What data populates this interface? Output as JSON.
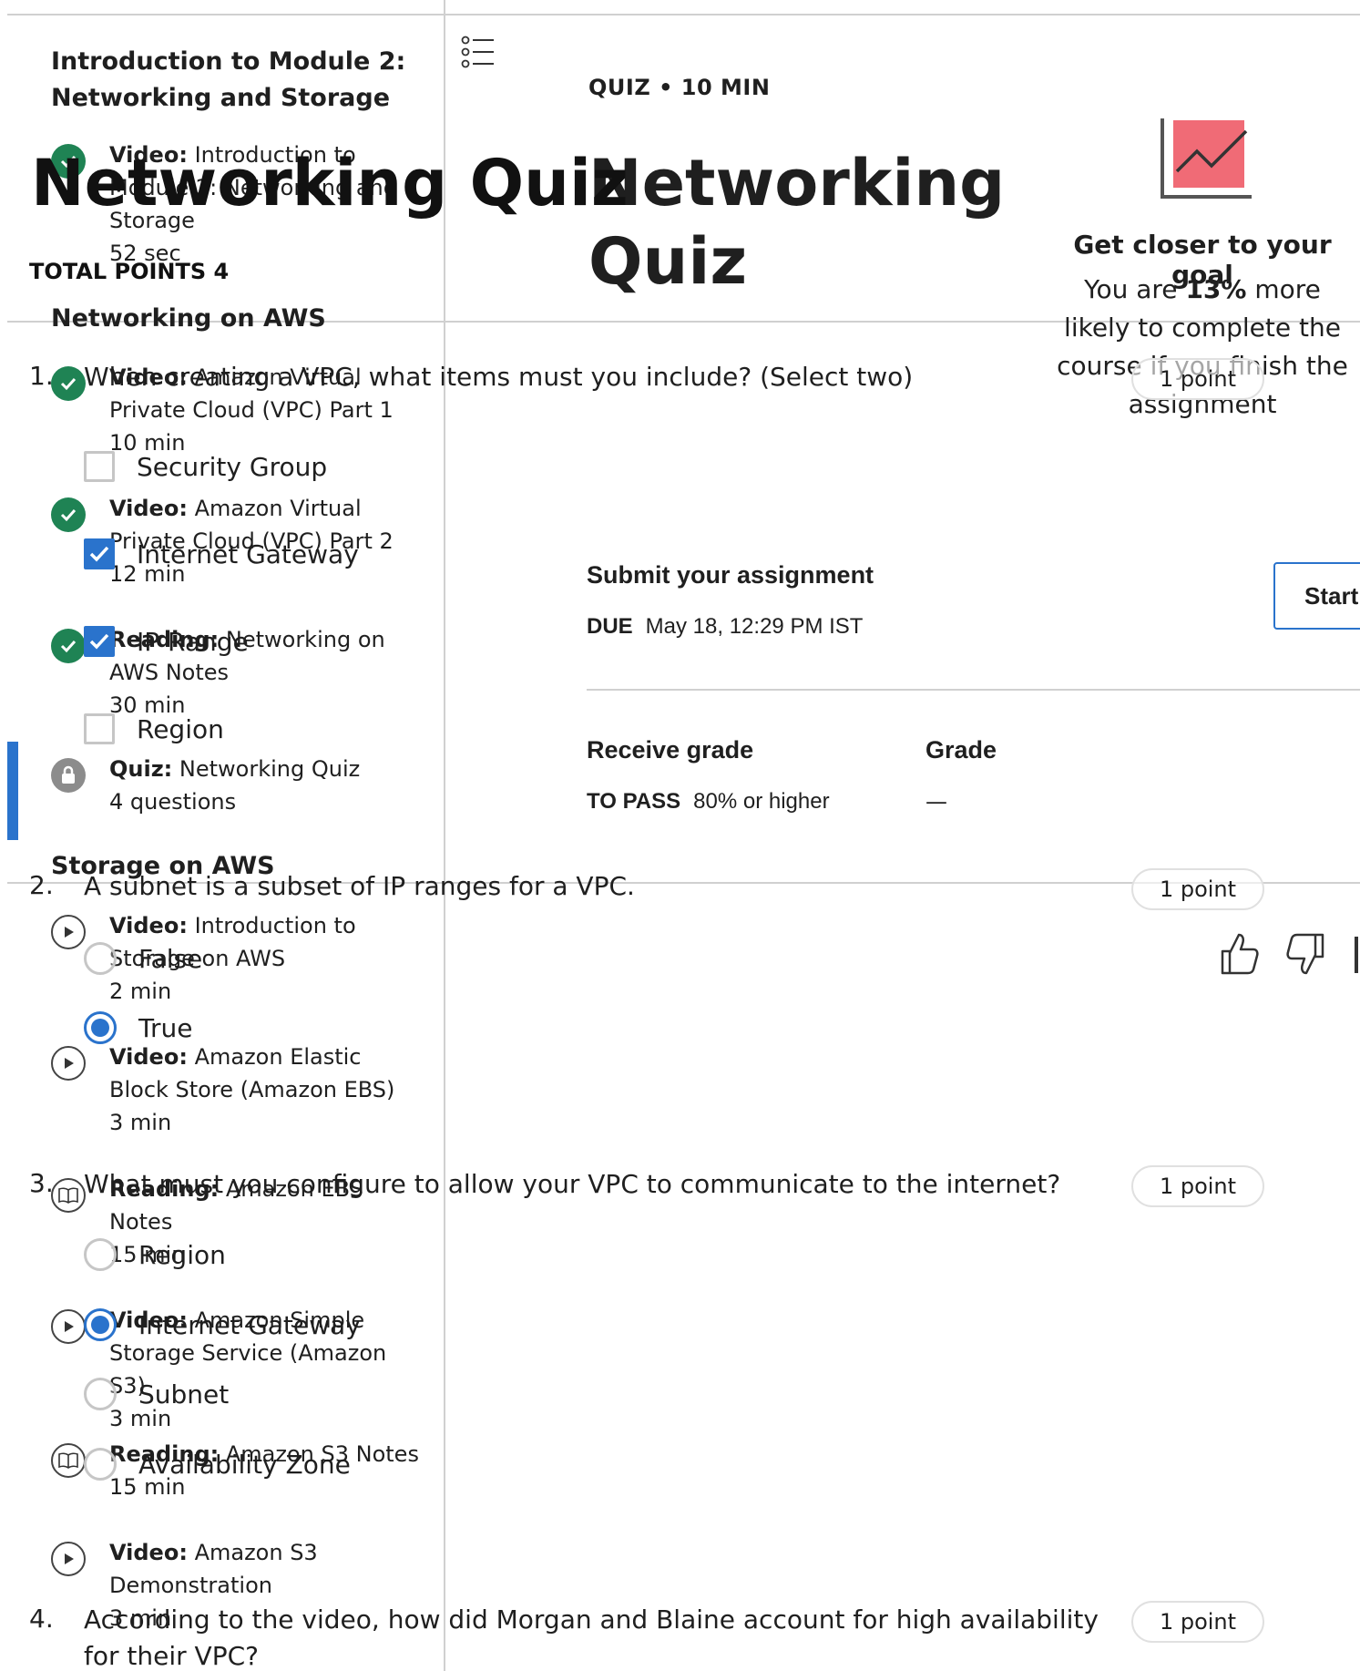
{
  "sidebar": {
    "title": "Introduction to Module 2: Networking and Storage",
    "items_top": [
      {
        "type": "Video:",
        "name": "Introduction to Module 2: Networking and Storage",
        "duration": "52 sec",
        "icon": "check-icon"
      }
    ],
    "section1": "Networking on AWS",
    "items_net": [
      {
        "type": "Video:",
        "name": "Amazon Virtual Private Cloud (VPC) Part 1",
        "duration": "10 min",
        "icon": "check-icon"
      },
      {
        "type": "Video:",
        "name": "Amazon Virtual Private Cloud (VPC) Part 2",
        "duration": "12 min",
        "icon": "check-icon"
      },
      {
        "type": "Reading:",
        "name": "Networking on AWS Notes",
        "duration": "30 min",
        "icon": "check-icon"
      },
      {
        "type": "Quiz:",
        "name": "Networking Quiz",
        "duration": "4 questions",
        "icon": "lock-icon"
      }
    ],
    "section2": "Storage on AWS",
    "items_storage": [
      {
        "type": "Video:",
        "name": "Introduction to Storage on AWS",
        "duration": "2 min",
        "icon": "play-icon"
      },
      {
        "type": "Video:",
        "name": "Amazon Elastic Block Store (Amazon EBS)",
        "duration": "3 min",
        "icon": "play-icon"
      },
      {
        "type": "Reading:",
        "name": "Amazon EBS Notes",
        "duration": "15 min",
        "icon": "book-icon"
      },
      {
        "type": "Video:",
        "name": "Amazon Simple Storage Service (Amazon S3)",
        "duration": "3 min",
        "icon": "play-icon"
      },
      {
        "type": "Reading:",
        "name": "Amazon S3 Notes",
        "duration": "15 min",
        "icon": "book-icon"
      },
      {
        "type": "Video:",
        "name": "Amazon S3 Demonstration",
        "duration": "3 min",
        "icon": "play-icon"
      }
    ]
  },
  "main": {
    "meta": "QUIZ • 10 MIN",
    "title": "Networking Quiz",
    "goal_heading": "Get closer to your goal",
    "goal_pre": "You are ",
    "goal_pct": "13%",
    "goal_post": " more likely to complete the course if you finish the assignment",
    "submit_heading": "Submit your assignment",
    "due_label": "DUE",
    "due_value": "May 18, 12:29 PM IST",
    "start_label": "Start",
    "receive_grade": "Receive grade",
    "grade_heading": "Grade",
    "pass_label": "TO PASS",
    "pass_value": "80% or higher",
    "grade_value": "—",
    "accent": "#2a73cc",
    "complete_color": "#1f8354",
    "chart_color": "#f06b76"
  },
  "quiz": {
    "title": "Networking Quiz",
    "total_points": "TOTAL POINTS 4",
    "questions": [
      {
        "num": "1.",
        "text": "When creating a VPC, what items must you include? (Select two)",
        "points": "1 point",
        "options": [
          {
            "label": "Security Group",
            "checked": false
          },
          {
            "label": "Internet Gateway",
            "checked": true
          },
          {
            "label": "IP Range",
            "checked": true
          },
          {
            "label": "Region",
            "checked": false
          }
        ]
      },
      {
        "num": "2.",
        "text": "A subnet is a subset of IP ranges for a VPC.",
        "points": "1 point",
        "options": [
          {
            "label": "False",
            "checked": false
          },
          {
            "label": "True",
            "checked": true
          }
        ]
      },
      {
        "num": "3.",
        "text": "What must you configure to allow your VPC to communicate to the internet?",
        "points": "1 point",
        "options": [
          {
            "label": "Region",
            "checked": false
          },
          {
            "label": "Internet Gateway",
            "checked": true
          },
          {
            "label": "Subnet",
            "checked": false
          },
          {
            "label": "Availability Zone",
            "checked": false
          }
        ]
      },
      {
        "num": "4.",
        "text": "According to the video, how did Morgan and Blaine account for high availability for their VPC?",
        "points": "1 point"
      }
    ]
  }
}
